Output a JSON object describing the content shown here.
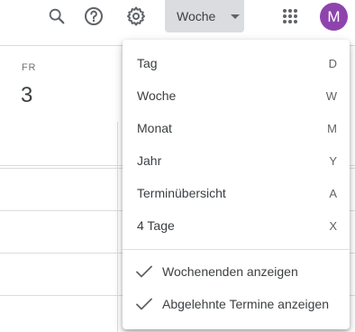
{
  "header": {
    "search_icon": "search-icon",
    "help_icon": "help-icon",
    "settings_icon": "gear-icon",
    "view_selector": {
      "label": "Woche"
    },
    "apps_icon": "apps-grid-icon",
    "avatar": {
      "letter": "M",
      "color": "#8e44ad"
    }
  },
  "day": {
    "weekday": "FR",
    "number": "3"
  },
  "view_menu": {
    "items": [
      {
        "label": "Tag",
        "shortcut": "D"
      },
      {
        "label": "Woche",
        "shortcut": "W"
      },
      {
        "label": "Monat",
        "shortcut": "M"
      },
      {
        "label": "Jahr",
        "shortcut": "Y"
      },
      {
        "label": "Terminübersicht",
        "shortcut": "A"
      },
      {
        "label": "4 Tage",
        "shortcut": "X"
      }
    ],
    "options": [
      {
        "label": "Wochenenden anzeigen",
        "checked": true
      },
      {
        "label": "Abgelehnte Termine anzeigen",
        "checked": true
      }
    ]
  }
}
